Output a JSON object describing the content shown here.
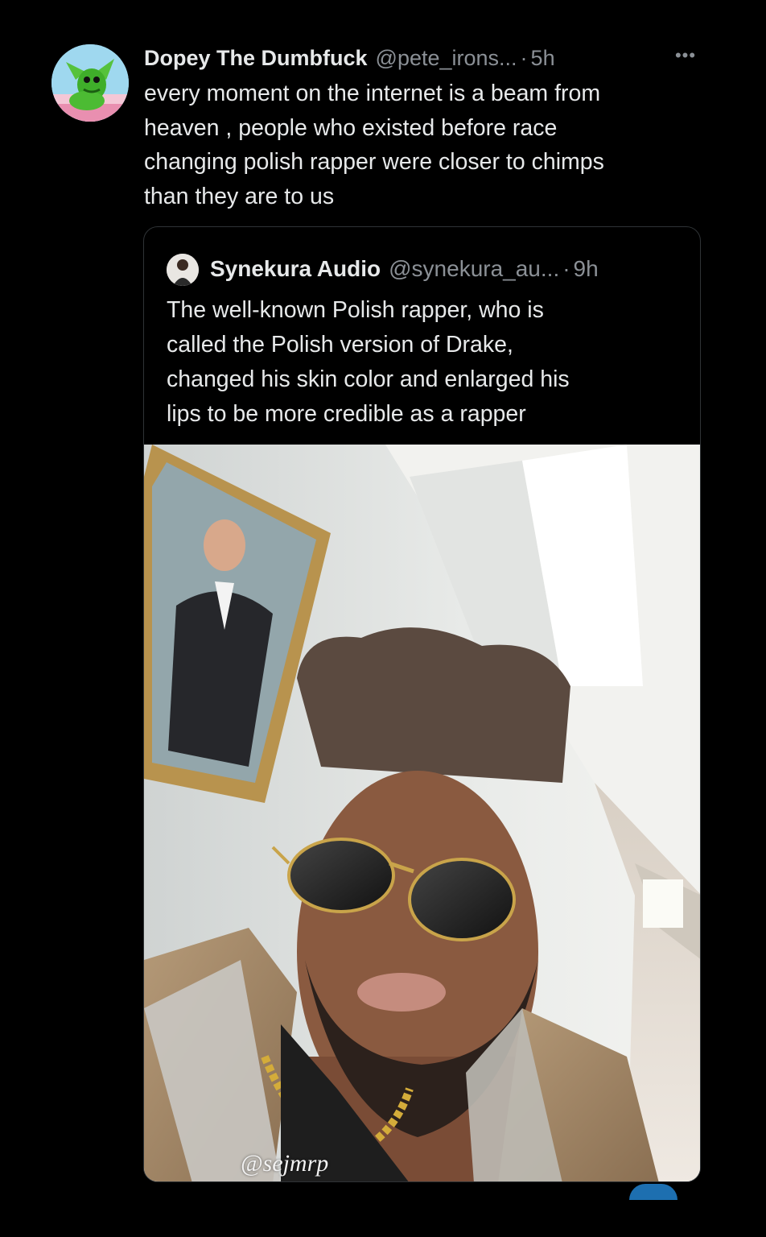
{
  "tweet": {
    "author_name": "Dopey The Dumbfuck",
    "author_handle": "@pete_irons...",
    "time": "5h",
    "separator": "·",
    "more_label": "•••",
    "lines": [
      "every moment on the internet is a beam from",
      "heaven , people who existed before race",
      "changing polish rapper were closer to chimps",
      "than they are to us"
    ]
  },
  "quote": {
    "author_name": "Synekura Audio",
    "author_handle": "@synekura_au...",
    "time": "9h",
    "separator": "·",
    "lines": [
      "The well-known Polish rapper, who is",
      "called the Polish version of Drake,",
      "changed his skin color and enlarged his",
      "lips to be more credible as a rapper"
    ],
    "photo_watermark": "@sejmrp"
  },
  "icons": {
    "avatar": "green-dragon-cartoon-avatar",
    "quote_avatar": "person-avatar",
    "more": "more-options-icon"
  }
}
